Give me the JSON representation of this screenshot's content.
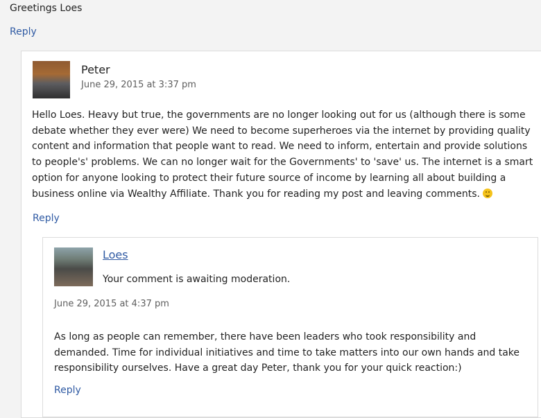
{
  "top_comment": {
    "closing_text": "Greetings Loes",
    "reply_label": "Reply"
  },
  "peter_comment": {
    "author": "Peter",
    "date": "June 29, 2015 at 3:37 pm",
    "body": "Hello Loes. Heavy but true, the governments are no longer looking out for us (although there is some debate whether they ever were) We need to become superheroes via the internet by providing quality content and information that people want to read. We need to inform, entertain and provide solutions to people's' problems. We can no longer wait for the Governments' to 'save' us. The internet is a smart option for anyone looking to protect their future source of income by learning all about building a business online via Wealthy Affiliate. Thank you for reading my post and leaving comments.",
    "reply_label": "Reply"
  },
  "loes_reply": {
    "author": "Loes",
    "moderation_text": "Your comment is awaiting moderation.",
    "date": "June 29, 2015 at 4:37 pm",
    "body": "As long as people can remember, there have been leaders who took responsibility and demanded. Time for individual initiatives and time to take matters into our own hands and take responsibility ourselves. Have a great day Peter, thank you for your quick reaction:)",
    "reply_label": "Reply"
  },
  "colors": {
    "background": "#f3f3f3",
    "card_background": "#ffffff",
    "link": "#2f5aa3",
    "text": "#222222",
    "meta_text": "#5e5e5e",
    "smiley": "#f4c21b"
  },
  "icons": {
    "smiley": "smiley-icon"
  }
}
